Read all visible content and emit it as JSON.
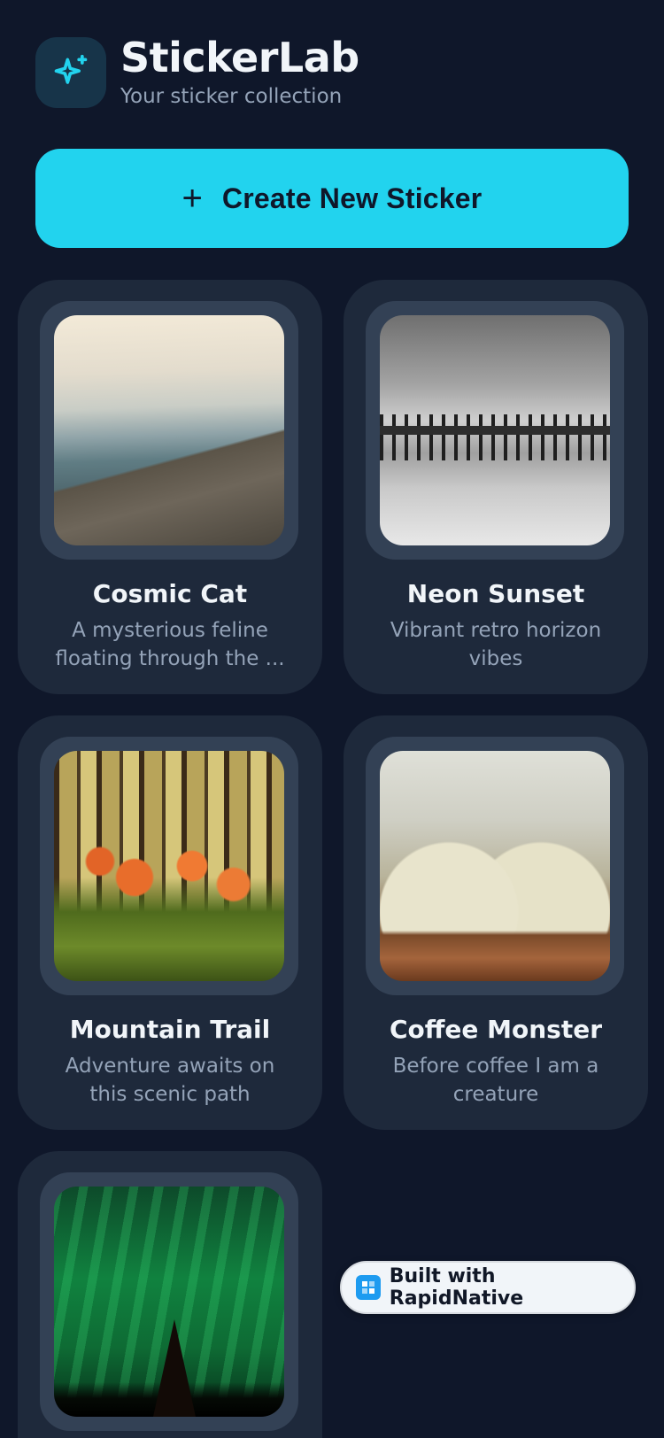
{
  "header": {
    "title": "StickerLab",
    "subtitle": "Your sticker collection",
    "icon": "sparkles-icon",
    "accent": "#22d3ee"
  },
  "create_button": {
    "icon": "plus-icon",
    "label": "Create New Sticker"
  },
  "stickers": [
    {
      "name": "Cosmic Cat",
      "description": "A mysterious feline floating through the ..."
    },
    {
      "name": "Neon Sunset",
      "description": "Vibrant retro horizon vibes"
    },
    {
      "name": "Mountain Trail",
      "description": "Adventure awaits on this scenic path"
    },
    {
      "name": "Coffee Monster",
      "description": "Before coffee I am a creature"
    },
    {
      "name": "",
      "description": ""
    }
  ],
  "badge": {
    "label": "Built with RapidNative",
    "icon": "rapidnative-logo-icon"
  },
  "colors": {
    "background": "#0f172a",
    "card": "#1e293b",
    "card_frame": "#334155",
    "accent": "#22d3ee"
  }
}
